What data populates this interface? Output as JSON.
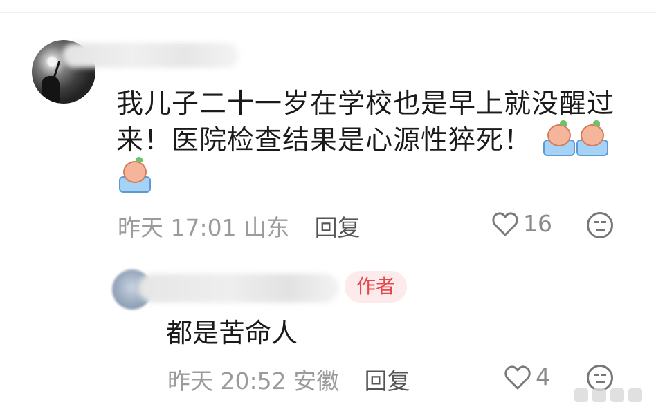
{
  "comment": {
    "text": "我儿子二十一岁在学校也是早上就没醒过来！医院检查结果是心源性猝死！",
    "emojis": [
      "crying-baby-emoji",
      "crying-baby-emoji",
      "crying-baby-emoji"
    ],
    "time_location": "昨天 17:01 山东",
    "reply_label": "回复",
    "likes": "16"
  },
  "reply": {
    "author_badge": "作者",
    "text": "都是苦命人",
    "time_location": "昨天 20:52 安徽",
    "reply_label": "回复",
    "likes": "4"
  },
  "icons": {
    "like": "heart-outline-icon",
    "dislike": "neutral-face-icon"
  }
}
